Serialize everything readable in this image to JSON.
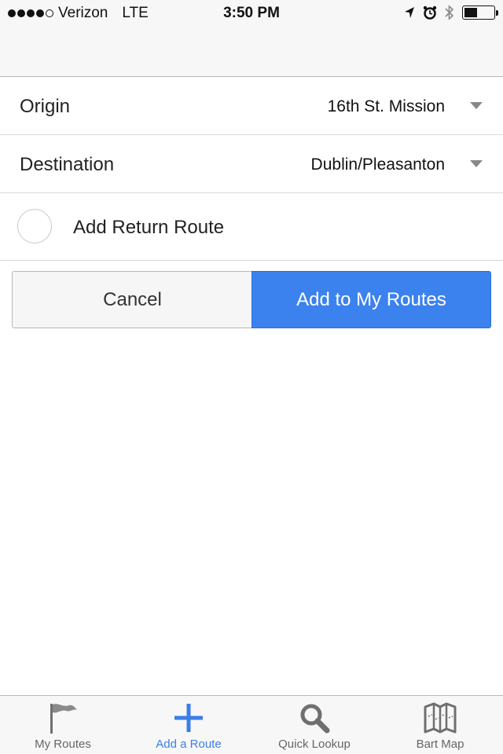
{
  "status_bar": {
    "carrier": "Verizon",
    "network": "LTE",
    "time": "3:50 PM",
    "signal_bars_filled": 4,
    "signal_bars_total": 5,
    "icons": [
      "location-icon",
      "alarm-icon",
      "bluetooth-icon",
      "battery-icon"
    ]
  },
  "form": {
    "origin": {
      "label": "Origin",
      "value": "16th St. Mission"
    },
    "destination": {
      "label": "Destination",
      "value": "Dublin/Pleasanton"
    },
    "return_route": {
      "label": "Add Return Route",
      "checked": false
    }
  },
  "actions": {
    "cancel_label": "Cancel",
    "add_label": "Add to My Routes"
  },
  "tab_bar": {
    "tabs": [
      {
        "label": "My Routes",
        "icon": "flag-icon",
        "active": false
      },
      {
        "label": "Add a Route",
        "icon": "plus-icon",
        "active": true
      },
      {
        "label": "Quick Lookup",
        "icon": "search-icon",
        "active": false
      },
      {
        "label": "Bart Map",
        "icon": "map-icon",
        "active": false
      }
    ]
  },
  "colors": {
    "accent": "#3b82ee",
    "active_tab": "#3b7ee8",
    "inactive_tab": "#666666"
  }
}
